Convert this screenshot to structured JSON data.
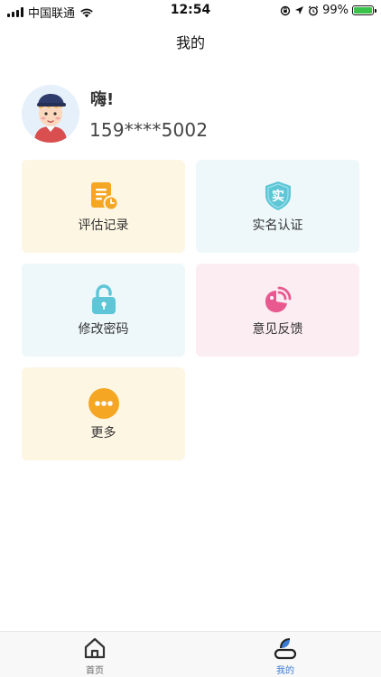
{
  "status_bar": {
    "carrier": "中国联通",
    "time": "12:54",
    "battery": "99%"
  },
  "header": {
    "title": "我的"
  },
  "profile": {
    "greeting": "嗨!",
    "phone": "159****5002"
  },
  "tiles": [
    {
      "label": "评估记录",
      "icon": "report-icon",
      "color": "#fdf6e3"
    },
    {
      "label": "实名认证",
      "icon": "verify-shield-icon",
      "color": "#eef8fb"
    },
    {
      "label": "修改密码",
      "icon": "unlock-icon",
      "color": "#eef8fb"
    },
    {
      "label": "意见反馈",
      "icon": "feedback-icon",
      "color": "#fcedf2"
    },
    {
      "label": "更多",
      "icon": "more-icon",
      "color": "#fdf6e3"
    }
  ],
  "tabbar": {
    "items": [
      {
        "label": "首页",
        "icon": "home-icon",
        "active": false
      },
      {
        "label": "我的",
        "icon": "profile-icon",
        "active": true
      }
    ]
  },
  "colors": {
    "accent": "#3a7bd5",
    "orange": "#f5a623",
    "teal": "#5ec6d6",
    "pink": "#e85a8f"
  }
}
